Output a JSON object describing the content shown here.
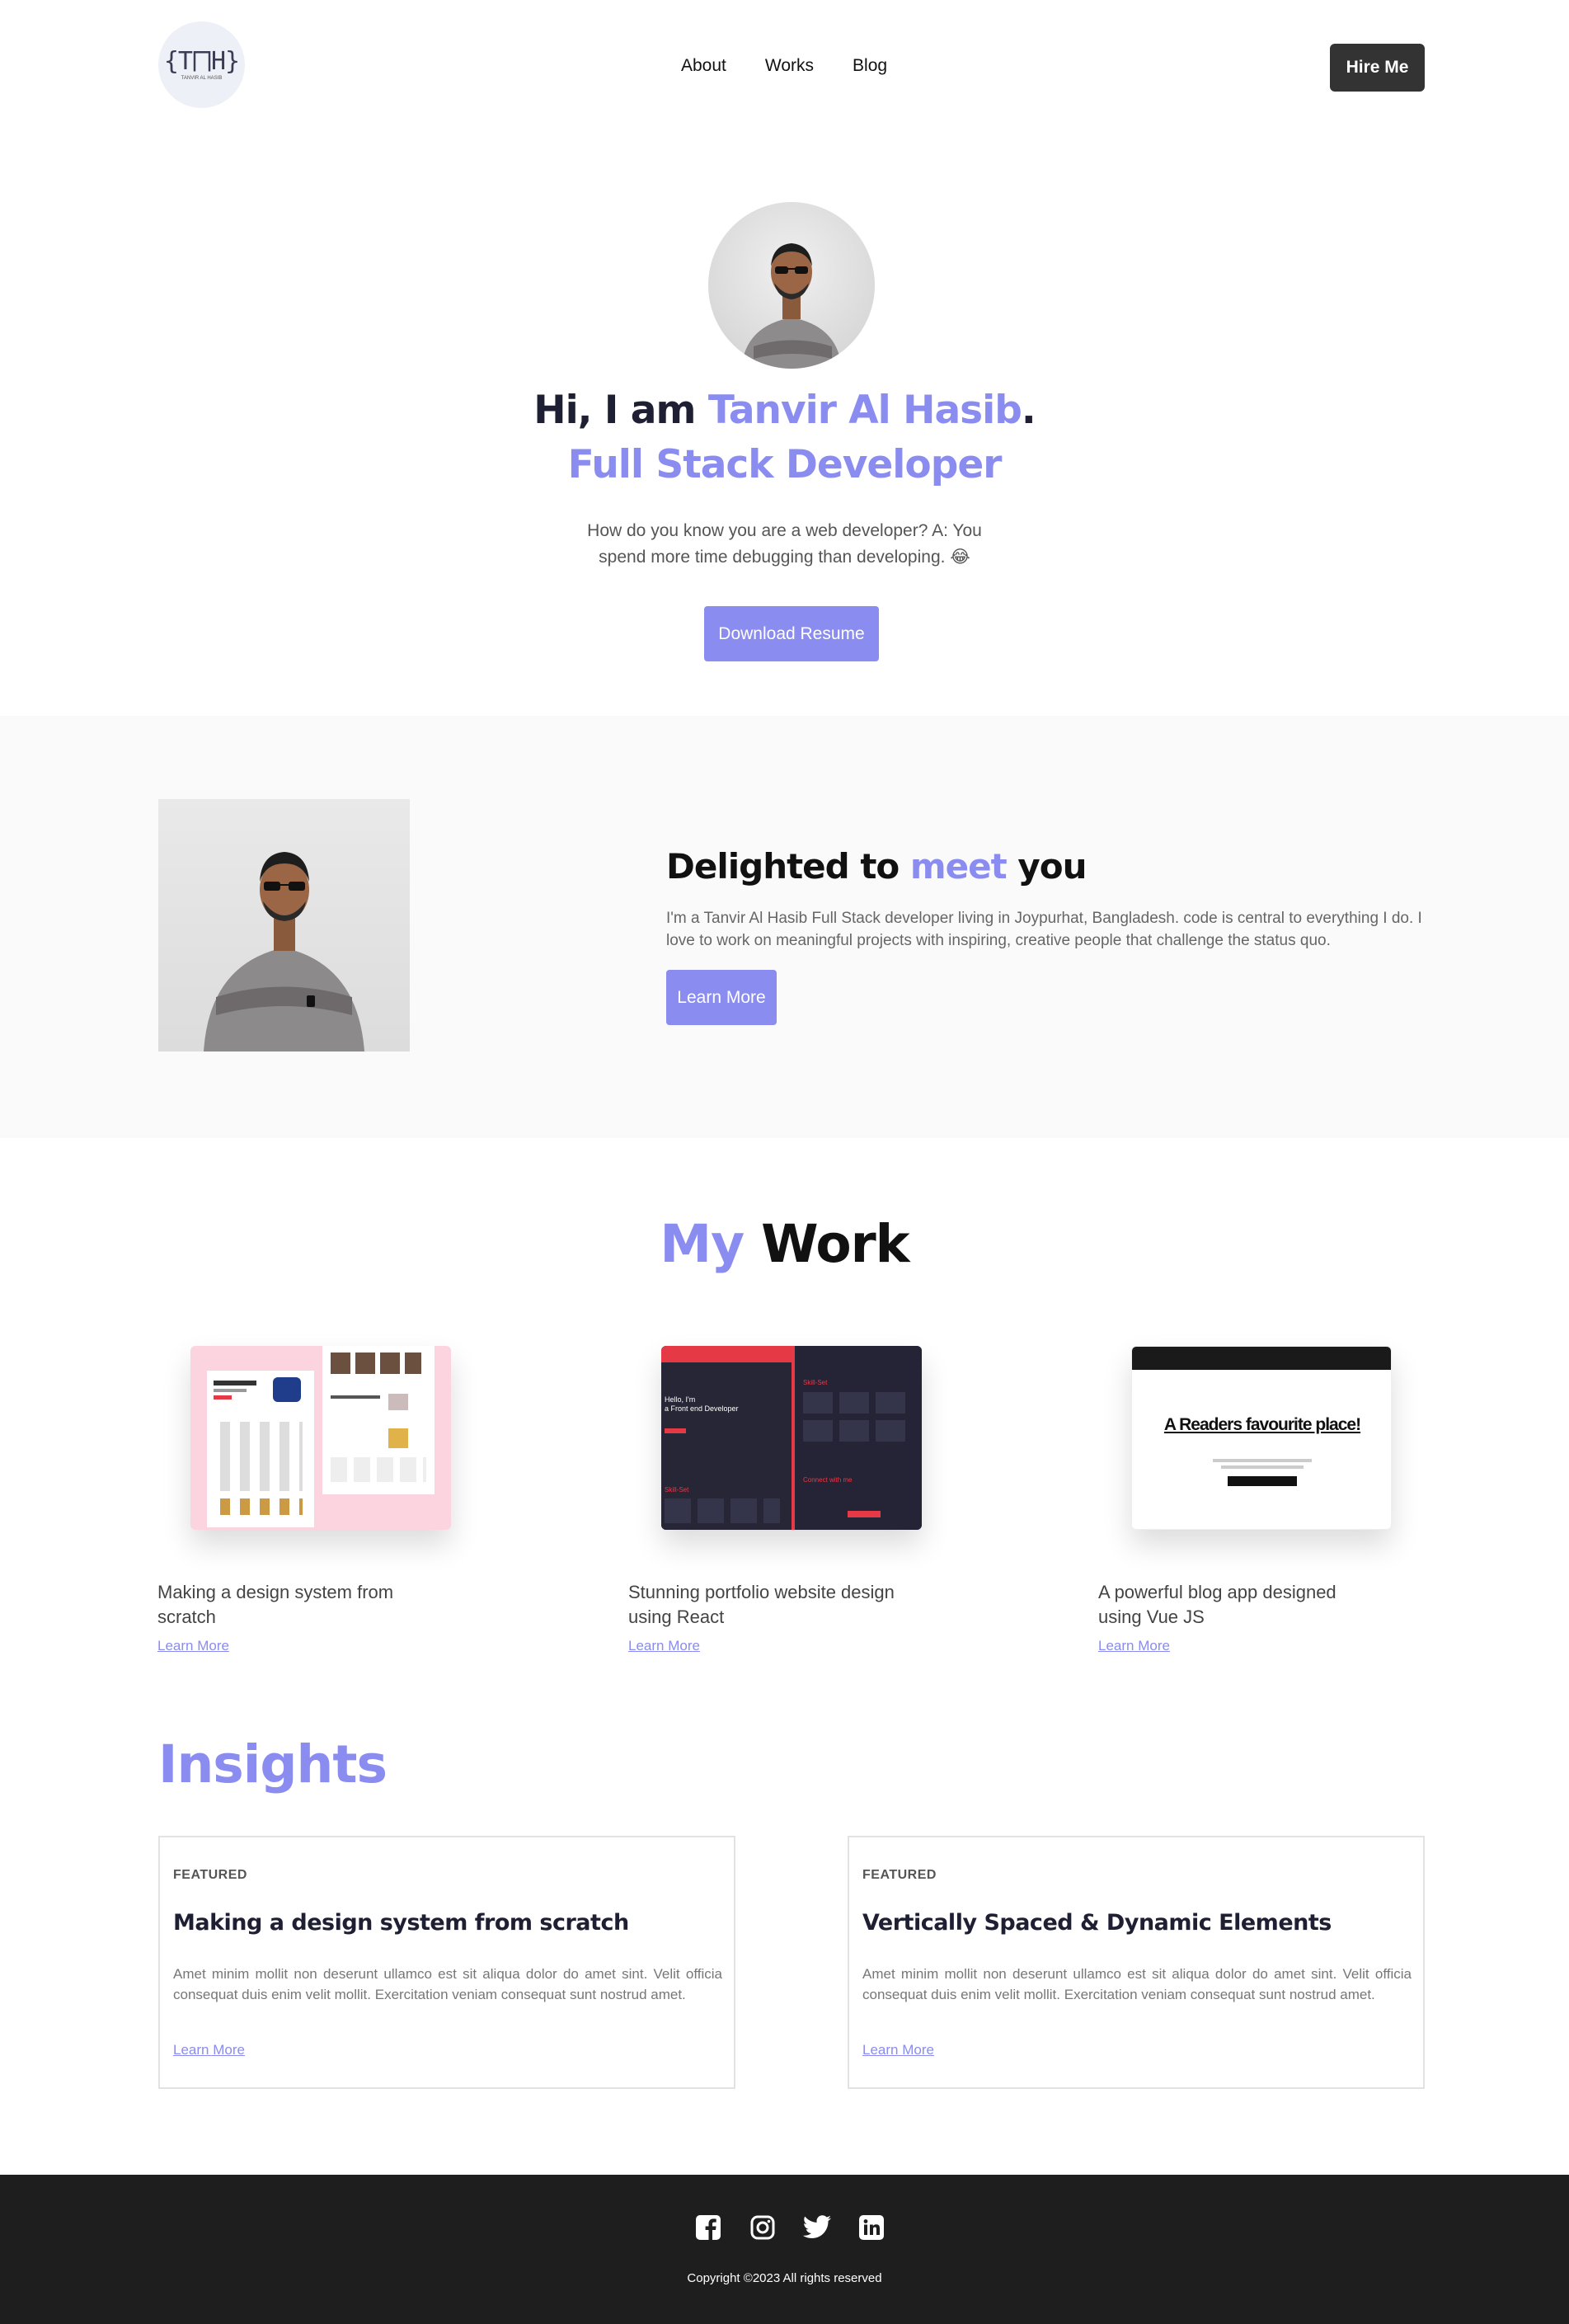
{
  "header": {
    "logo_mark": "{T⨅H}",
    "logo_sub": "TANVIR AL HASIB",
    "nav": [
      "About",
      "Works",
      "Blog"
    ],
    "hire_label": "Hire Me"
  },
  "hero": {
    "greeting": "Hi, I am ",
    "name": "Tanvir Al Hasib",
    "period": ".",
    "role": "Full Stack Developer",
    "description": "How do you know you are a web developer? A: You spend more time debugging than developing. 😂",
    "cta_label": "Download Resume"
  },
  "about": {
    "title_pre": "Delighted to ",
    "title_accent": "meet",
    "title_post": " you",
    "text": "I'm a Tanvir Al Hasib Full Stack developer living in Joypurhat, Bangladesh. code is central to everything I do. I love to work on meaningful projects with inspiring, creative people that challenge the status quo.",
    "cta_label": "Learn More"
  },
  "work": {
    "title_accent": "My",
    "title_rest": " Work",
    "items": [
      {
        "caption": "Making a design system from scratch",
        "link": "Learn More"
      },
      {
        "caption": "Stunning portfolio website design using React",
        "link": "Learn More"
      },
      {
        "caption": "A powerful blog app designed using Vue JS",
        "link": "Learn More"
      }
    ],
    "thumb2_hero": "Hello, I'm\na Front end Developer",
    "thumb2_skill": "Skill-Set",
    "thumb2_contact": "Connect with me",
    "thumb3_headline": "A Readers favourite place!"
  },
  "insights": {
    "title": "Insights",
    "posts": [
      {
        "tag": "FEATURED",
        "title": "Making a design system from scratch",
        "body": "Amet minim mollit non deserunt ullamco est sit aliqua dolor do amet sint. Velit officia consequat duis enim velit mollit. Exercitation veniam consequat sunt nostrud amet.",
        "link": "Learn More"
      },
      {
        "tag": "FEATURED",
        "title": "Vertically Spaced & Dynamic Elements",
        "body": "Amet minim mollit non deserunt ullamco est sit aliqua dolor do amet sint. Velit officia consequat duis enim velit mollit. Exercitation veniam consequat sunt nostrud amet.",
        "link": "Learn More"
      }
    ]
  },
  "footer": {
    "socials": [
      "facebook-icon",
      "instagram-icon",
      "twitter-icon",
      "linkedin-icon"
    ],
    "copyright": "Copyright ©2023 All rights reserved"
  },
  "colors": {
    "accent": "#8a8cf0",
    "dark_button": "#333333",
    "footer_bg": "#1e1e1e"
  }
}
